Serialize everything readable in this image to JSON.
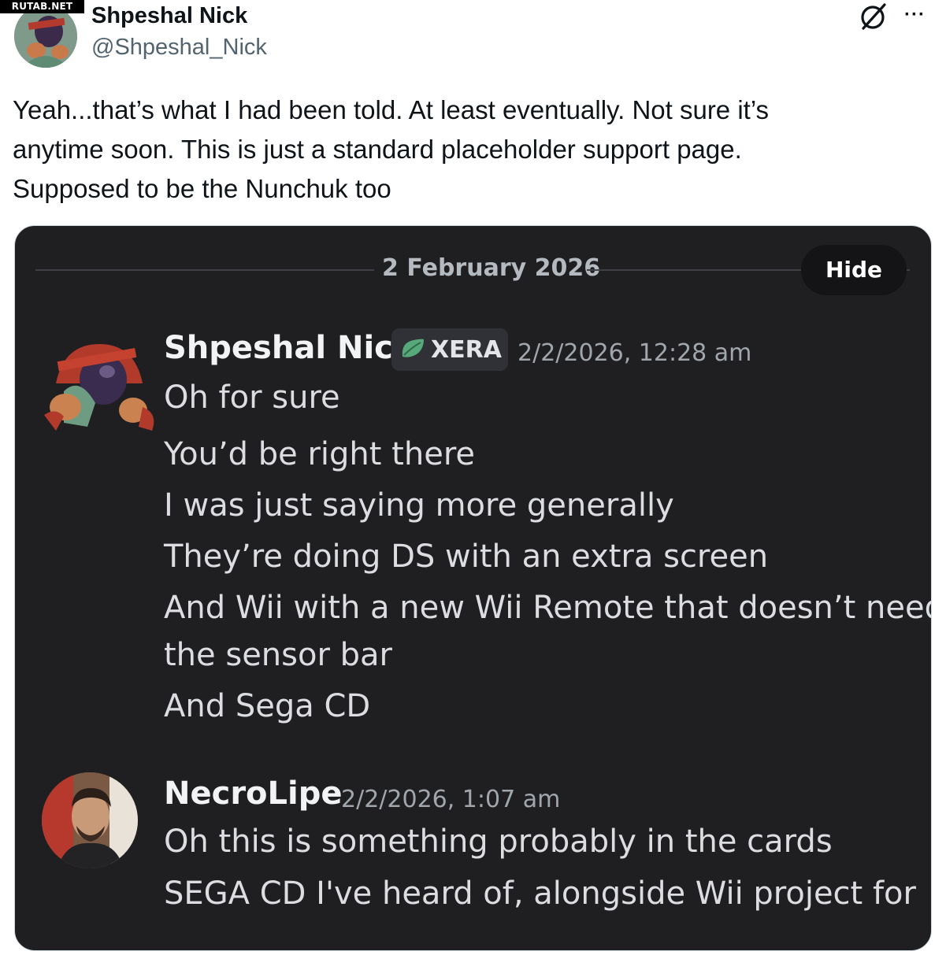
{
  "watermark": "RUTAB.NET",
  "tweet": {
    "author_name": "Shpeshal Nick",
    "handle": "@Shpeshal_Nick",
    "text_lines": [
      "Yeah...that’s what I had been told. At least eventually. Not sure it’s",
      "anytime soon. This is just a standard placeholder support page.",
      "Supposed to be the Nunchuk too"
    ],
    "icons": {
      "grok": "grok-icon",
      "more": "more-options-icon"
    },
    "more_label": "···"
  },
  "discord": {
    "date_divider": "2 February 2026",
    "hide_label": "Hide",
    "messages": [
      {
        "author": "Shpeshal Nick",
        "tag": "XERA",
        "timestamp": "2/2/2026, 12:28 am",
        "lines": [
          "Oh for sure",
          "You’d be right there",
          "I was just saying more generally",
          "They’re doing DS with an extra screen",
          "And Wii with a new Wii Remote that doesn’t need",
          "the sensor bar",
          "And Sega CD"
        ]
      },
      {
        "author": "NecroLipe",
        "timestamp": "2/2/2026, 1:07 am",
        "lines": [
          "Oh this is something probably in the cards",
          "SEGA CD I've heard of, alongside Wii project for"
        ]
      }
    ],
    "colors": {
      "background": "#1f1f22",
      "text": "#dcdde1",
      "muted": "#a1a6ad",
      "tag_leaf": "#57a87a"
    }
  }
}
